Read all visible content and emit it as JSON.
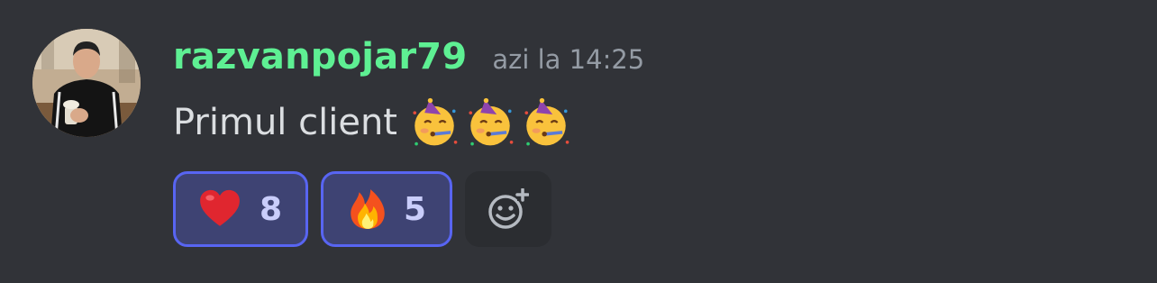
{
  "message": {
    "author": "razvanpojar79",
    "timestamp": "azi la 14:25",
    "text": "Primul client",
    "text_emojis": [
      "partying-face",
      "partying-face",
      "partying-face"
    ],
    "author_color": "#5ef093"
  },
  "reactions": [
    {
      "emoji": "red-heart",
      "count": "8",
      "selected": true
    },
    {
      "emoji": "fire",
      "count": "5",
      "selected": true
    }
  ],
  "add_reaction": {
    "icon": "add-reaction-icon"
  },
  "colors": {
    "background": "#313338",
    "reaction_selected_bg": "#3e4373",
    "reaction_selected_border": "#5865f2",
    "timestamp": "#949ba4"
  }
}
